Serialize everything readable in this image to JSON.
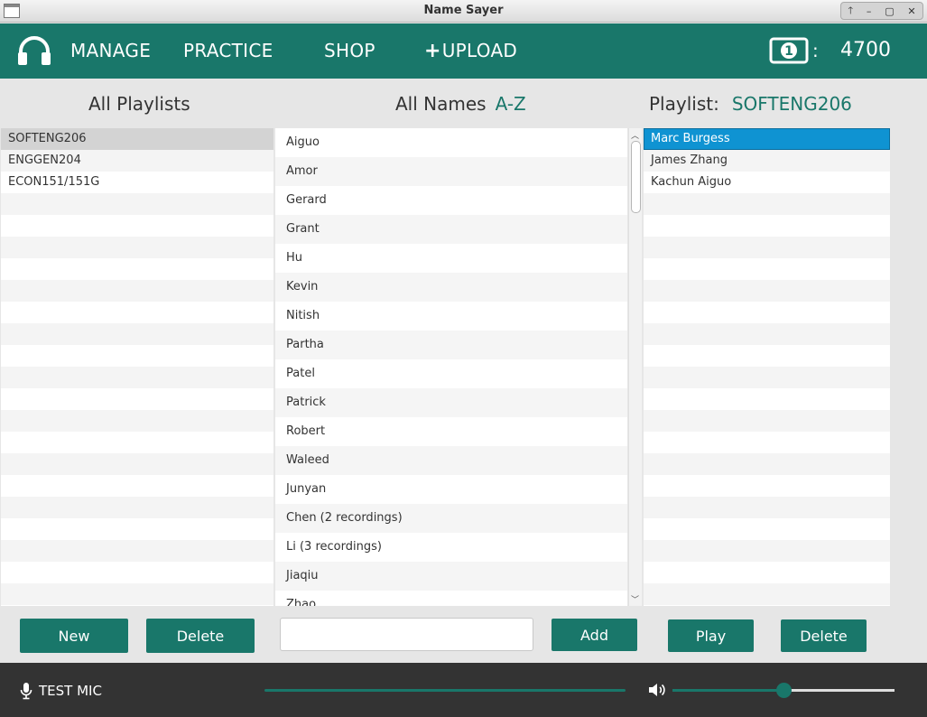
{
  "window": {
    "title": "Name Sayer",
    "controls": [
      "🡑",
      "–",
      "▢",
      "✕"
    ]
  },
  "nav": {
    "items": [
      {
        "label": "MANAGE"
      },
      {
        "label": "PRACTICE"
      },
      {
        "label": "SHOP"
      },
      {
        "label": "UPLOAD"
      }
    ],
    "upload_plus": "+",
    "money_colon": ":",
    "money_amount": "4700",
    "money_icon_digit": "1"
  },
  "headers": {
    "playlists": "All Playlists",
    "names": "All Names",
    "names_sort": "A-Z",
    "playlist": "Playlist:",
    "playlist_name": "SOFTENG206"
  },
  "playlists": {
    "items": [
      "SOFTENG206",
      "ENGGEN204",
      "ECON151/151G"
    ],
    "selected": "SOFTENG206"
  },
  "names": {
    "items": [
      "Aiguo",
      "Amor",
      "Gerard",
      "Grant",
      "Hu",
      "Kevin",
      "Nitish",
      "Partha",
      "Patel",
      "Patrick",
      "Robert",
      "Waleed",
      "Junyan",
      "Chen (2 recordings)",
      "Li (3 recordings)",
      "Jiaqiu",
      "Zhao"
    ],
    "input_value": ""
  },
  "playlist_names": {
    "items": [
      "Marc Burgess",
      "James Zhang",
      "Kachun Aiguo"
    ],
    "selected": "Marc Burgess"
  },
  "buttons": {
    "new": "New",
    "delete_playlist": "Delete",
    "add": "Add",
    "play": "Play",
    "delete_name": "Delete"
  },
  "bottom": {
    "test_mic": "TEST MIC",
    "volume_fraction": 0.5
  },
  "colors": {
    "accent": "#19776a",
    "selection": "#0f93d2",
    "bottom_bar": "#333333"
  }
}
